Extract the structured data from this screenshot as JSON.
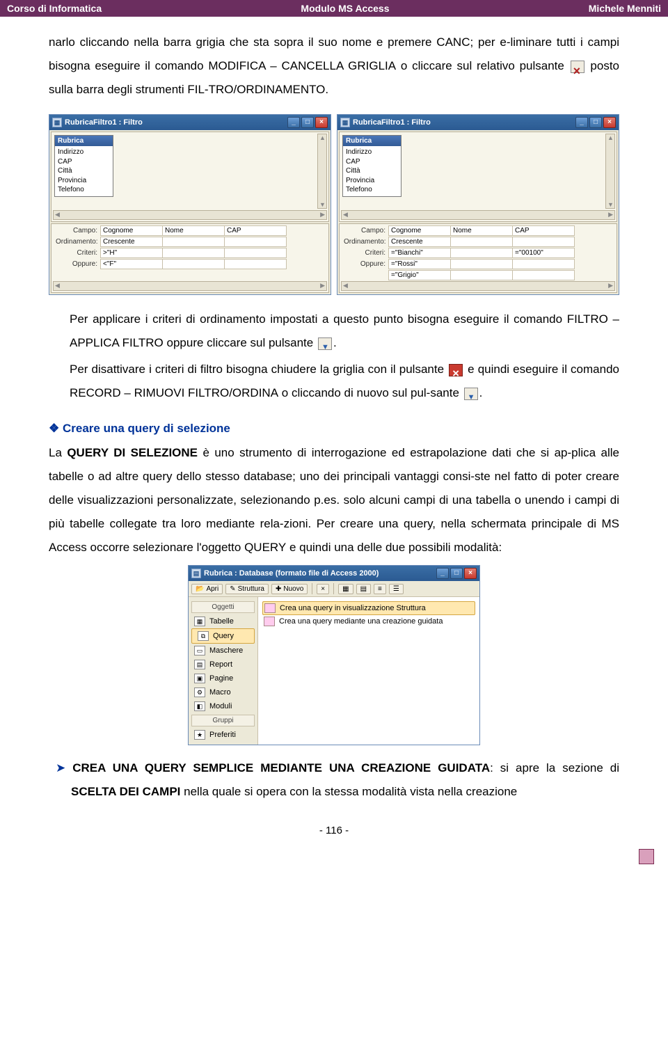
{
  "header": {
    "left": "Corso di Informatica",
    "center": "Modulo MS Access",
    "right": "Michele Menniti"
  },
  "para1_a": "narlo cliccando nella barra grigia che sta sopra il suo nome e premere ",
  "para1_canc": "CANC",
  "para1_b": "; per e-liminare tutti i campi bisogna eseguire il comando ",
  "para1_cmd1": "MODIFICA – CANCELLA GRIGLIA",
  "para1_c": " o cliccare sul relativo pulsante ",
  "para1_d": " posto sulla barra degli strumenti ",
  "para1_cmd2": "FIL-TRO/ORDINAMENTO",
  "para1_e": ".",
  "win_title": "RubricaFiltro1 : Filtro",
  "table_name": "Rubrica",
  "fields": {
    "f1": "Indirizzo",
    "f2": "CAP",
    "f3": "Città",
    "f4": "Provincia",
    "f5": "Telefono"
  },
  "grid_labels": {
    "campo": "Campo:",
    "ordinamento": "Ordinamento:",
    "criteri": "Criteri:",
    "oppure": "Oppure:"
  },
  "grid_left": {
    "r1": {
      "c1": "Cognome",
      "c2": "Nome",
      "c3": "CAP"
    },
    "r2": {
      "c1": "Crescente",
      "c2": "",
      "c3": ""
    },
    "r3": {
      "c1": ">\"H\"",
      "c2": "",
      "c3": ""
    },
    "r4": {
      "c1": "<\"F\"",
      "c2": "",
      "c3": ""
    }
  },
  "grid_right": {
    "r1": {
      "c1": "Cognome",
      "c2": "Nome",
      "c3": "CAP"
    },
    "r2": {
      "c1": "Crescente",
      "c2": "",
      "c3": ""
    },
    "r3": {
      "c1": "=\"Bianchi\"",
      "c2": "",
      "c3": "=\"00100\""
    },
    "r4": {
      "c1": "=\"Rossi\"",
      "c2": "",
      "c3": ""
    },
    "r5": {
      "c1": "=\"Grigio\"",
      "c2": "",
      "c3": ""
    }
  },
  "para2_a": "Per applicare i criteri di ordinamento impostati a questo punto bisogna eseguire il comando ",
  "para2_cmd": "FILTRO – APPLICA FILTRO",
  "para2_b": " oppure cliccare sul pulsante ",
  "para2_c": ".",
  "para3_a": "Per disattivare i criteri di filtro bisogna chiudere la griglia con il pulsante ",
  "para3_b": " e quindi eseguire il comando ",
  "para3_cmd": "RECORD – RIMUOVI FILTRO/ORDINA",
  "para3_c": " o cliccando di nuovo sul pul-sante ",
  "para3_d": ".",
  "section_title": "Creare una query di selezione",
  "para4_a": "La ",
  "para4_cmd": "QUERY DI SELEZIONE",
  "para4_b": " è uno strumento di interrogazione ed estrapolazione dati che si ap-plica alle tabelle o ad altre query dello stesso database; uno dei principali vantaggi consi-ste nel fatto di poter creare delle visualizzazioni personalizzate, selezionando p.es. solo alcuni campi di una tabella o unendo i campi di più tabelle collegate tra loro mediante rela-zioni. Per creare una query, nella schermata principale di MS Access occorre selezionare l'oggetto ",
  "para4_cmd2": "QUERY",
  "para4_c": " e quindi una delle due possibili modalità:",
  "db": {
    "title": "Rubrica : Database (formato file di Access 2000)",
    "tb": {
      "apri": "Apri",
      "struttura": "Struttura",
      "nuovo": "Nuovo"
    },
    "side_group1": "Oggetti",
    "side": {
      "s1": "Tabelle",
      "s2": "Query",
      "s3": "Maschere",
      "s4": "Report",
      "s5": "Pagine",
      "s6": "Macro",
      "s7": "Moduli"
    },
    "side_group2": "Gruppi",
    "side_fav": "Preferiti",
    "row1": "Crea una query in visualizzazione Struttura",
    "row2": "Crea una query mediante una creazione guidata"
  },
  "bullet_a1": "CREA UNA QUERY SEMPLICE MEDIANTE UNA CREAZIONE GUIDATA",
  "bullet_a2": ": si apre la sezione di ",
  "bullet_a3": "SCELTA DEI CAMPI",
  "bullet_a4": " nella quale si opera con la stessa modalità vista nella creazione",
  "page_num": "- 116 -"
}
